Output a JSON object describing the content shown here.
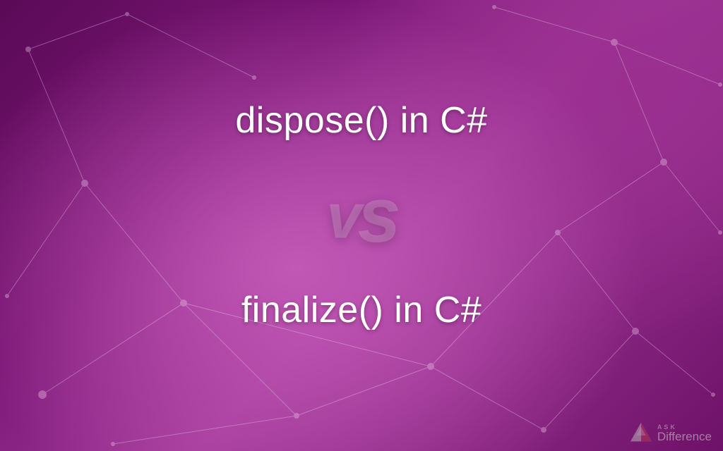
{
  "term_top": "dispose() in C#",
  "vs_label": "vs",
  "term_bottom": "finalize() in C#",
  "brand": {
    "ask": "ASK",
    "name": "Difference"
  },
  "colors": {
    "bg_primary": "#7a1675",
    "bg_glow": "#c258b6",
    "text": "#ffffff",
    "mesh": "#f3d6ef",
    "brand_accent": "#b03a52"
  }
}
